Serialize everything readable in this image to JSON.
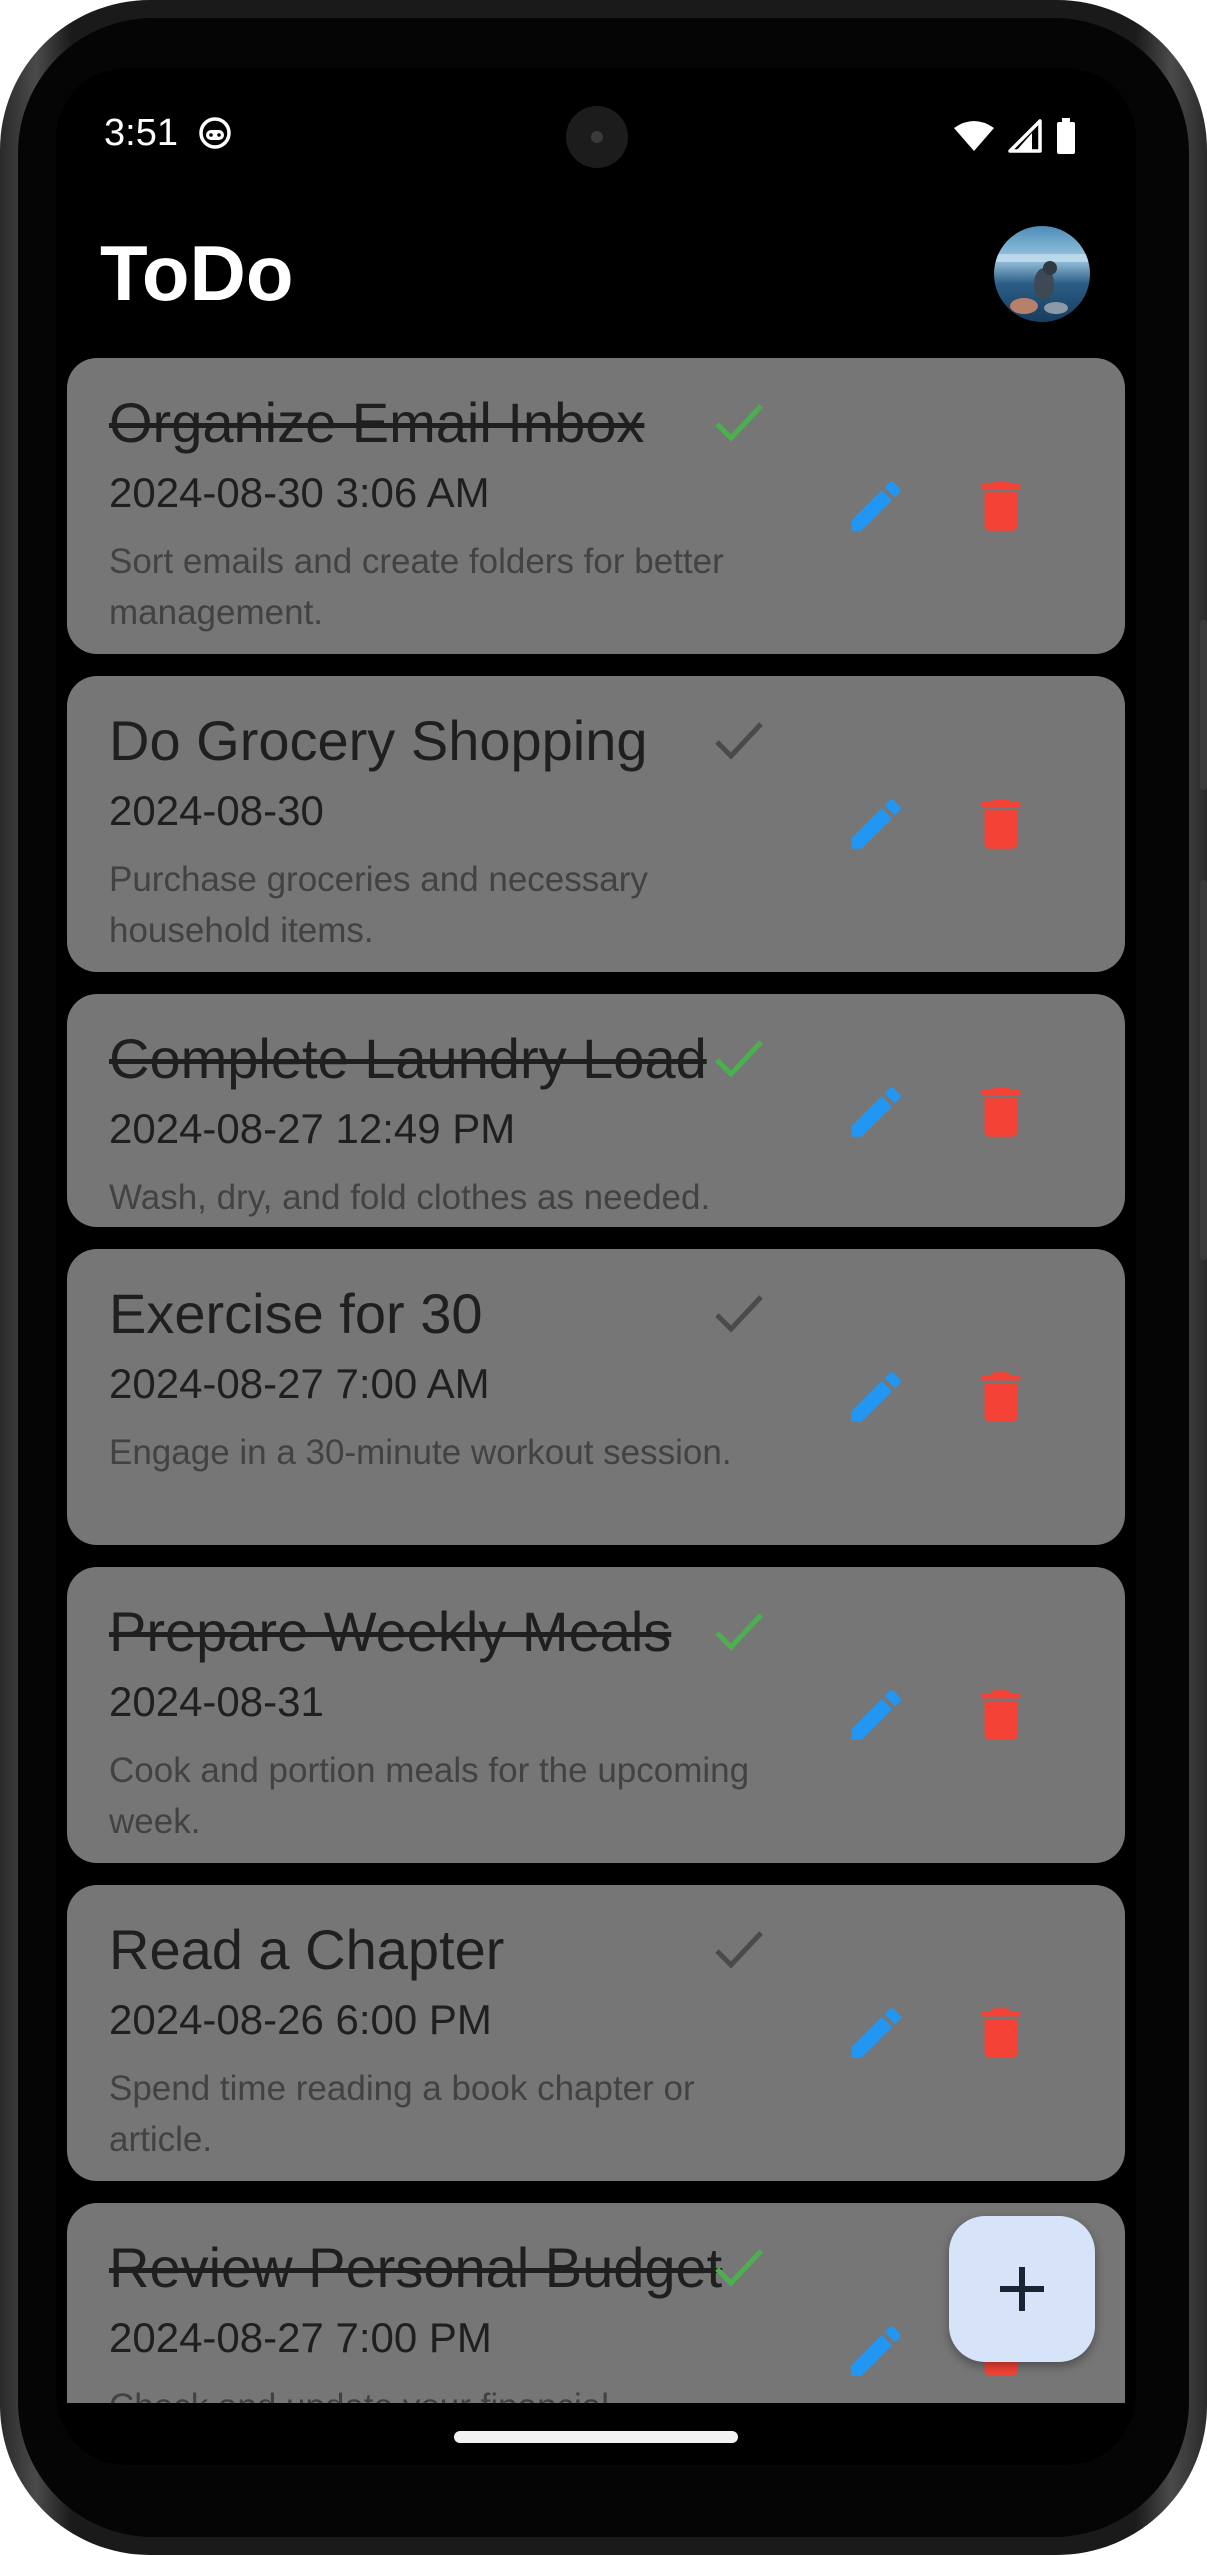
{
  "status_bar": {
    "time": "3:51",
    "app_icon": "android-notification-icon",
    "icons": [
      "wifi-icon",
      "cellular-signal-icon",
      "battery-icon"
    ]
  },
  "app_bar": {
    "title": "ToDo",
    "avatar": "profile-avatar"
  },
  "colors": {
    "card_background": "#767676",
    "done_check": "#4caf50",
    "pending_check": "#4a4a4a",
    "edit_icon": "#2196f3",
    "delete_icon": "#f44336",
    "fab_background": "#d6e3f8"
  },
  "todos": [
    {
      "title": "Organize Email Inbox",
      "done": true,
      "date": "2024-08-30  3:06 AM",
      "description": "Sort emails and create folders for better management."
    },
    {
      "title": "Do Grocery Shopping",
      "done": false,
      "date": "2024-08-30",
      "description": "Purchase groceries and necessary household items."
    },
    {
      "title": "Complete Laundry Load",
      "done": true,
      "date": "2024-08-27  12:49 PM",
      "description": "Wash, dry, and fold clothes as needed."
    },
    {
      "title": "Exercise for 30",
      "done": false,
      "date": "2024-08-27  7:00 AM",
      "description": "Engage in a 30-minute workout session."
    },
    {
      "title": "Prepare Weekly Meals",
      "done": true,
      "date": "2024-08-31",
      "description": "Cook and portion meals for the upcoming week."
    },
    {
      "title": "Read a Chapter",
      "done": false,
      "date": "2024-08-26  6:00 PM",
      "description": "Spend time reading a book chapter or article."
    },
    {
      "title": "Review Personal Budget",
      "done": true,
      "date": "2024-08-27  7:00 PM",
      "description": "Check and update your financial"
    }
  ],
  "fab": {
    "label": "+",
    "icon": "add-icon"
  }
}
